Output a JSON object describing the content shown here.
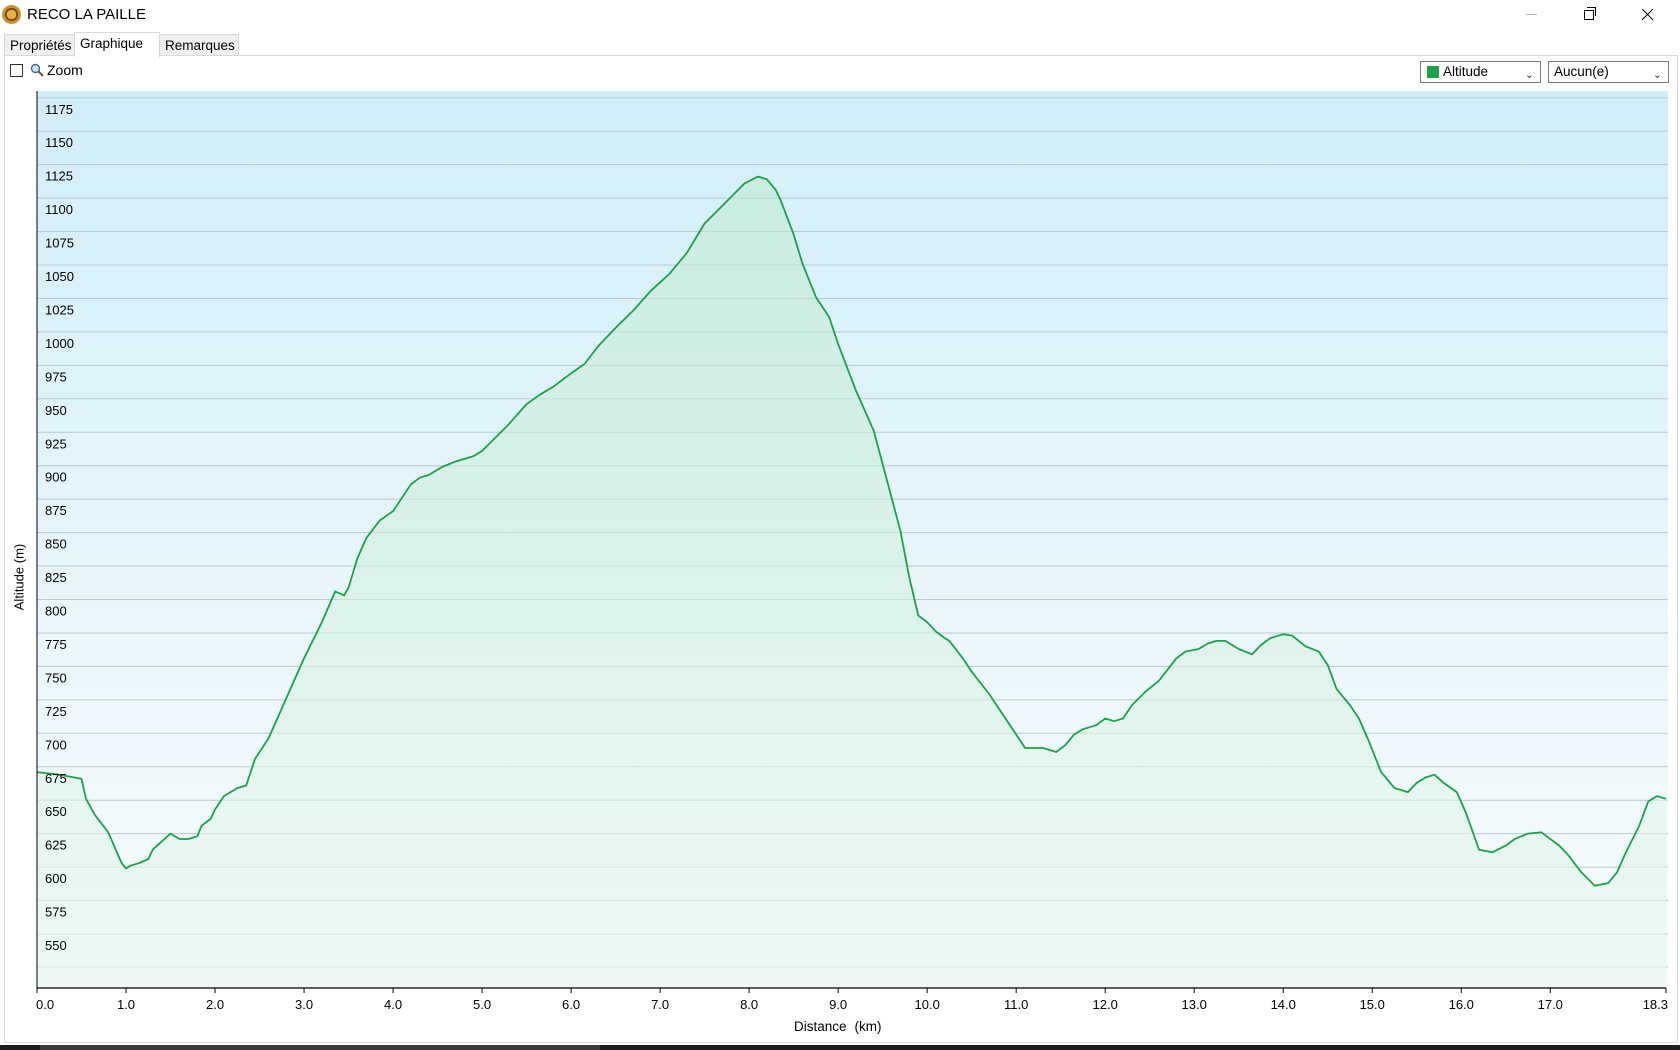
{
  "window": {
    "title": "RECO LA PAILLE"
  },
  "tabs": [
    {
      "label": "Propriétés",
      "active": false
    },
    {
      "label": "Graphique",
      "active": true
    },
    {
      "label": "Remarques",
      "active": false
    }
  ],
  "toolbar": {
    "zoom_label": "Zoom",
    "zoom_checked": false,
    "series_select": {
      "value": "Altitude",
      "color": "#1ba24a"
    },
    "overlay_select": {
      "value": "Aucun(e)"
    }
  },
  "chart_data": {
    "type": "area",
    "ylabel": "Altitude (m)",
    "xlabel": "Distance",
    "xunit": "(km)",
    "yticks": [
      550,
      575,
      600,
      625,
      650,
      675,
      700,
      725,
      750,
      775,
      800,
      825,
      850,
      875,
      900,
      925,
      950,
      975,
      1000,
      1025,
      1050,
      1075,
      1100,
      1125,
      1150,
      1175
    ],
    "xticks": [
      "0.0",
      "1.0",
      "2.0",
      "3.0",
      "4.0",
      "5.0",
      "6.0",
      "7.0",
      "8.0",
      "9.0",
      "10.0",
      "11.0",
      "12.0",
      "13.0",
      "14.0",
      "15.0",
      "16.0",
      "17.0",
      "18.3"
    ],
    "xlim": [
      0,
      18.3
    ],
    "ylim": [
      525,
      1200
    ],
    "grid": true,
    "line_color": "#1ba24a",
    "series": [
      {
        "name": "Altitude",
        "x": [
          0.0,
          0.25,
          0.5,
          0.55,
          0.65,
          0.8,
          0.95,
          1.0,
          1.05,
          1.15,
          1.25,
          1.3,
          1.4,
          1.5,
          1.6,
          1.7,
          1.8,
          1.85,
          1.95,
          2.0,
          2.1,
          2.25,
          2.35,
          2.45,
          2.6,
          2.8,
          3.0,
          3.2,
          3.35,
          3.45,
          3.5,
          3.6,
          3.7,
          3.85,
          4.0,
          4.1,
          4.2,
          4.3,
          4.4,
          4.55,
          4.7,
          4.9,
          5.0,
          5.15,
          5.3,
          5.5,
          5.65,
          5.8,
          6.0,
          6.15,
          6.3,
          6.5,
          6.7,
          6.9,
          7.1,
          7.3,
          7.5,
          7.65,
          7.8,
          7.95,
          8.1,
          8.2,
          8.3,
          8.35,
          8.5,
          8.6,
          8.75,
          8.9,
          9.0,
          9.2,
          9.4,
          9.6,
          9.7,
          9.8,
          9.9,
          10.0,
          10.1,
          10.2,
          10.25,
          10.4,
          10.5,
          10.7,
          10.9,
          11.1,
          11.3,
          11.45,
          11.55,
          11.65,
          11.75,
          11.9,
          12.0,
          12.1,
          12.2,
          12.3,
          12.45,
          12.6,
          12.8,
          12.9,
          13.05,
          13.15,
          13.25,
          13.35,
          13.5,
          13.65,
          13.75,
          13.85,
          14.0,
          14.1,
          14.25,
          14.4,
          14.5,
          14.6,
          14.75,
          14.85,
          14.95,
          15.1,
          15.25,
          15.4,
          15.5,
          15.6,
          15.7,
          15.8,
          15.95,
          16.05,
          16.2,
          16.35,
          16.5,
          16.6,
          16.75,
          16.9,
          17.0,
          17.1,
          17.2,
          17.35,
          17.5,
          17.65,
          17.75,
          17.85,
          18.0,
          18.1,
          18.2,
          18.3
        ],
        "values": [
          680,
          678,
          675,
          660,
          648,
          635,
          612,
          608,
          610,
          612,
          615,
          622,
          628,
          634,
          630,
          630,
          632,
          640,
          645,
          652,
          662,
          668,
          670,
          690,
          705,
          735,
          765,
          792,
          815,
          812,
          818,
          840,
          855,
          868,
          875,
          885,
          895,
          900,
          902,
          908,
          912,
          916,
          920,
          930,
          940,
          955,
          962,
          968,
          978,
          985,
          998,
          1012,
          1025,
          1040,
          1052,
          1068,
          1090,
          1100,
          1110,
          1120,
          1125,
          1123,
          1115,
          1108,
          1082,
          1060,
          1035,
          1020,
          1000,
          965,
          935,
          885,
          860,
          825,
          797,
          792,
          785,
          780,
          778,
          765,
          755,
          738,
          718,
          698,
          698,
          695,
          700,
          708,
          712,
          715,
          720,
          718,
          720,
          730,
          740,
          748,
          765,
          770,
          772,
          776,
          778,
          778,
          772,
          768,
          775,
          780,
          783,
          782,
          774,
          770,
          760,
          742,
          730,
          720,
          705,
          680,
          668,
          665,
          672,
          676,
          678,
          672,
          665,
          650,
          622,
          620,
          625,
          630,
          634,
          635,
          630,
          625,
          618,
          605,
          595,
          597,
          605,
          620,
          640,
          658,
          662,
          660
        ]
      }
    ]
  }
}
